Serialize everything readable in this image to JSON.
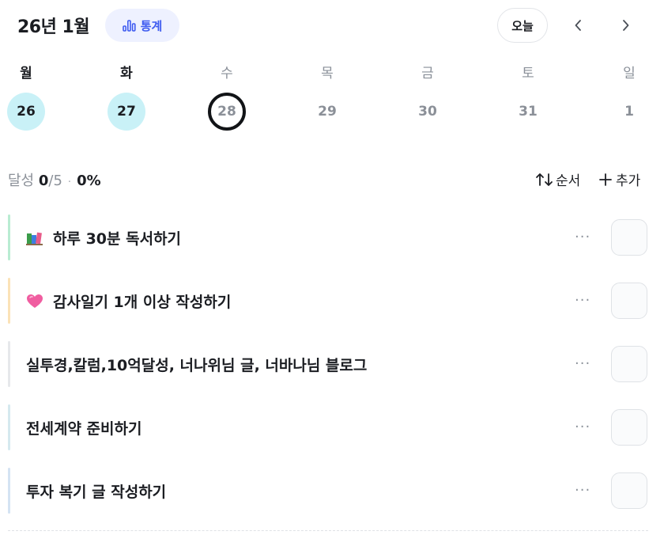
{
  "header": {
    "month_label": "26년 1월",
    "stats_label": "통계",
    "today_label": "오늘",
    "prev_glyph": "‹",
    "next_glyph": "›"
  },
  "week": {
    "days": [
      {
        "weekday": "월",
        "date": "26",
        "state": "done"
      },
      {
        "weekday": "화",
        "date": "27",
        "state": "done"
      },
      {
        "weekday": "수",
        "date": "28",
        "state": "today"
      },
      {
        "weekday": "목",
        "date": "29",
        "state": "future"
      },
      {
        "weekday": "금",
        "date": "30",
        "state": "future"
      },
      {
        "weekday": "토",
        "date": "31",
        "state": "future"
      },
      {
        "weekday": "일",
        "date": "1",
        "state": "future"
      }
    ]
  },
  "progress": {
    "label": "달성",
    "done": "0",
    "total": "/5",
    "percent": "0%"
  },
  "actions": {
    "sort_label": "순서",
    "add_label": "추가"
  },
  "tasks": [
    {
      "title": "하루 30분 독서하기",
      "icon": "books-emoji",
      "bar_color": "#b9ecd2"
    },
    {
      "title": "감사일기 1개 이상 작성하기",
      "icon": "pink-heart-emoji",
      "bar_color": "#fbe2b7"
    },
    {
      "title": "실투경,칼럼,10억달성, 너나위님 글, 너바나님 블로그",
      "icon": "",
      "bar_color": "#e6e8eb"
    },
    {
      "title": "전세계약 준비하기",
      "icon": "",
      "bar_color": "#d5e9ef"
    },
    {
      "title": "투자 복기 글 작성하기",
      "icon": "",
      "bar_color": "#d4e3f3"
    }
  ],
  "more_glyph": "···"
}
